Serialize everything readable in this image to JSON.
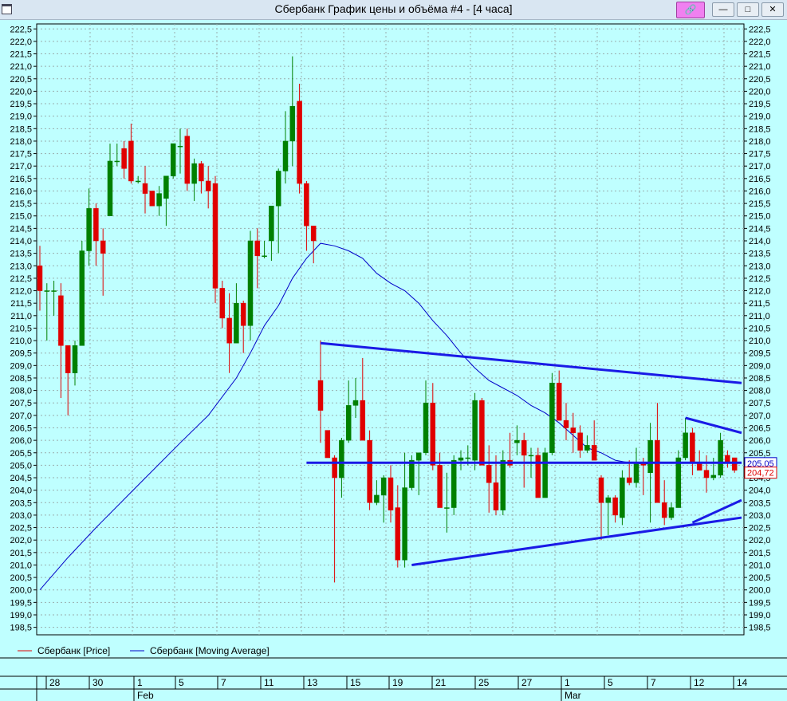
{
  "window": {
    "title": "Сбербанк График цены и объёма #4 - [4 часа]",
    "pin_icon": "pin-icon",
    "minimize_icon": "minimize-icon",
    "maximize_icon": "maximize-icon",
    "close_icon": "close-icon"
  },
  "colors": {
    "background": "#bfffff",
    "grid": "#9aaeae",
    "up": "#008000",
    "down": "#e00000",
    "ma": "#0000c8",
    "trendline": "#1a1ae6"
  },
  "legend": {
    "price": "Сбербанк [Price]",
    "ma": "Сбербанк [Moving Average]"
  },
  "price_labels": {
    "ma_last": "205,05",
    "price_last": "204,72"
  },
  "chart_data": {
    "type": "candlestick",
    "ylim": [
      198.2,
      222.7
    ],
    "y_ticks": [
      "222,5",
      "222,0",
      "221,5",
      "221,0",
      "220,5",
      "220,0",
      "219,5",
      "219,0",
      "218,5",
      "218,0",
      "217,5",
      "217,0",
      "216,5",
      "216,0",
      "215,5",
      "215,0",
      "214,5",
      "214,0",
      "213,5",
      "213,0",
      "212,5",
      "212,0",
      "211,5",
      "211,0",
      "210,5",
      "210,0",
      "209,5",
      "209,0",
      "208,5",
      "208,0",
      "207,5",
      "207,0",
      "206,5",
      "206,0",
      "205,5",
      "205,0",
      "204,5",
      "204,0",
      "203,5",
      "203,0",
      "202,5",
      "202,0",
      "201,5",
      "201,0",
      "200,5",
      "200,0",
      "199,5",
      "199,0",
      "198,5"
    ],
    "x_ticks": [
      "28",
      "30",
      "1",
      "5",
      "7",
      "11",
      "13",
      "15",
      "19",
      "21",
      "25",
      "27",
      "1",
      "5",
      "7",
      "12",
      "14"
    ],
    "month_labels": [
      "Feb",
      "Mar"
    ],
    "candles": [
      [
        213.0,
        213.8,
        211.2,
        212.0
      ],
      [
        212.0,
        212.3,
        210.0,
        212.0
      ],
      [
        212.0,
        212.4,
        211.0,
        212.0
      ],
      [
        211.8,
        212.3,
        207.7,
        209.8
      ],
      [
        209.8,
        209.8,
        207.0,
        208.7
      ],
      [
        208.7,
        210.0,
        208.2,
        209.8
      ],
      [
        209.8,
        214.0,
        209.8,
        213.6
      ],
      [
        213.6,
        216.1,
        213.0,
        215.3
      ],
      [
        215.3,
        215.5,
        213.0,
        214.0
      ],
      [
        214.0,
        214.5,
        211.8,
        213.5
      ],
      [
        215.0,
        217.9,
        215.0,
        217.2
      ],
      [
        217.2,
        217.9,
        217.0,
        217.2
      ],
      [
        217.7,
        218.0,
        216.5,
        216.9
      ],
      [
        218.0,
        218.7,
        216.3,
        216.4
      ],
      [
        216.4,
        216.6,
        216.3,
        216.4
      ],
      [
        216.3,
        217.0,
        215.1,
        215.9
      ],
      [
        216.0,
        216.0,
        215.4,
        215.4
      ],
      [
        215.4,
        216.2,
        215.0,
        215.9
      ],
      [
        215.7,
        216.5,
        214.6,
        216.6
      ],
      [
        216.6,
        217.8,
        216.5,
        217.9
      ],
      [
        217.8,
        218.5,
        216.7,
        217.8
      ],
      [
        218.2,
        218.5,
        216.0,
        216.3
      ],
      [
        216.3,
        217.3,
        215.6,
        217.1
      ],
      [
        217.1,
        217.2,
        215.9,
        216.4
      ],
      [
        216.4,
        217.0,
        215.3,
        216.0
      ],
      [
        216.3,
        216.6,
        211.5,
        212.1
      ],
      [
        212.1,
        212.4,
        210.5,
        210.9
      ],
      [
        210.9,
        211.9,
        208.7,
        209.9
      ],
      [
        209.9,
        212.3,
        209.9,
        211.5
      ],
      [
        211.5,
        211.6,
        209.5,
        210.6
      ],
      [
        210.6,
        214.4,
        210.0,
        214.0
      ],
      [
        214.0,
        214.5,
        212.1,
        213.4
      ],
      [
        213.4,
        214.0,
        213.3,
        213.4
      ],
      [
        214.0,
        215.0,
        213.2,
        215.4
      ],
      [
        215.4,
        216.9,
        213.5,
        216.8
      ],
      [
        216.8,
        219.2,
        216.3,
        218.0
      ],
      [
        218.0,
        221.4,
        217.0,
        219.4
      ],
      [
        219.6,
        220.3,
        215.9,
        216.3
      ],
      [
        216.3,
        216.4,
        213.6,
        214.6
      ],
      [
        214.6,
        214.6,
        213.1,
        214.0
      ],
      [
        208.4,
        210.0,
        205.9,
        207.2
      ],
      [
        206.4,
        206.3,
        205.4,
        205.3
      ],
      [
        205.3,
        205.4,
        200.3,
        204.5
      ],
      [
        204.5,
        206.1,
        203.7,
        206.0
      ],
      [
        206.0,
        208.4,
        205.9,
        207.4
      ],
      [
        207.4,
        208.5,
        206.9,
        207.6
      ],
      [
        207.6,
        209.3,
        206.9,
        206.0
      ],
      [
        206.0,
        206.4,
        203.2,
        203.5
      ],
      [
        203.5,
        204.4,
        203.4,
        203.8
      ],
      [
        203.8,
        204.6,
        202.7,
        204.5
      ],
      [
        204.5,
        205.0,
        202.7,
        203.2
      ],
      [
        203.3,
        204.2,
        200.9,
        201.2
      ],
      [
        201.2,
        205.5,
        200.9,
        204.1
      ],
      [
        204.1,
        205.4,
        204.0,
        205.2
      ],
      [
        205.2,
        205.5,
        203.8,
        205.5
      ],
      [
        205.5,
        208.4,
        205.4,
        207.5
      ],
      [
        207.5,
        208.3,
        204.8,
        205.0
      ],
      [
        205.0,
        205.5,
        203.6,
        203.3
      ],
      [
        203.3,
        204.7,
        202.3,
        203.3
      ],
      [
        203.3,
        205.4,
        203.0,
        205.2
      ],
      [
        205.2,
        205.6,
        204.8,
        205.3
      ],
      [
        205.3,
        205.8,
        205.0,
        205.3
      ],
      [
        205.2,
        207.9,
        204.8,
        207.6
      ],
      [
        207.6,
        207.7,
        205.9,
        205.0
      ],
      [
        205.0,
        205.8,
        203.1,
        204.3
      ],
      [
        204.3,
        205.4,
        203.0,
        203.2
      ],
      [
        203.2,
        205.6,
        203.0,
        205.2
      ],
      [
        205.2,
        206.3,
        204.9,
        205.0
      ],
      [
        205.9,
        206.6,
        205.4,
        206.0
      ],
      [
        206.0,
        206.3,
        204.1,
        205.4
      ],
      [
        205.4,
        205.7,
        204.5,
        205.4
      ],
      [
        205.4,
        205.7,
        203.9,
        203.7
      ],
      [
        203.7,
        205.7,
        204.2,
        205.5
      ],
      [
        205.5,
        208.7,
        205.4,
        208.3
      ],
      [
        208.3,
        208.8,
        206.9,
        206.8
      ],
      [
        206.8,
        207.5,
        206.0,
        206.5
      ],
      [
        206.5,
        207.1,
        205.5,
        206.3
      ],
      [
        206.3,
        206.6,
        205.3,
        205.6
      ],
      [
        205.6,
        206.2,
        205.5,
        205.8
      ],
      [
        205.8,
        206.8,
        205.3,
        205.2
      ],
      [
        204.5,
        204.6,
        202.0,
        203.5
      ],
      [
        203.5,
        203.8,
        202.2,
        203.7
      ],
      [
        203.7,
        203.8,
        202.7,
        203.0
      ],
      [
        202.9,
        204.8,
        202.6,
        204.5
      ],
      [
        204.5,
        205.2,
        204.2,
        204.3
      ],
      [
        204.3,
        205.7,
        204.1,
        205.1
      ],
      [
        205.1,
        205.3,
        203.8,
        205.0
      ],
      [
        204.7,
        206.7,
        202.7,
        206.0
      ],
      [
        206.0,
        207.5,
        204.4,
        203.5
      ],
      [
        203.5,
        204.4,
        202.6,
        202.9
      ],
      [
        202.9,
        203.5,
        202.8,
        203.3
      ],
      [
        203.3,
        205.6,
        203.4,
        205.3
      ],
      [
        205.3,
        206.9,
        205.2,
        206.3
      ],
      [
        206.3,
        206.5,
        204.6,
        205.1
      ],
      [
        205.1,
        205.6,
        204.8,
        204.8
      ],
      [
        204.8,
        205.4,
        203.9,
        204.5
      ],
      [
        204.5,
        205.3,
        204.4,
        204.6
      ],
      [
        204.6,
        206.3,
        204.5,
        206.0
      ],
      [
        205.4,
        205.6,
        204.9,
        205.1
      ],
      [
        205.3,
        205.3,
        204.7,
        204.8
      ]
    ],
    "moving_average": [
      [
        0,
        200.0
      ],
      [
        4,
        201.3
      ],
      [
        8,
        202.5
      ],
      [
        14,
        204.2
      ],
      [
        20,
        205.9
      ],
      [
        24,
        207.0
      ],
      [
        28,
        208.5
      ],
      [
        30,
        209.5
      ],
      [
        32,
        210.6
      ],
      [
        34,
        211.4
      ],
      [
        36,
        212.5
      ],
      [
        38,
        213.3
      ],
      [
        40,
        213.9
      ],
      [
        42,
        213.8
      ],
      [
        44,
        213.6
      ],
      [
        46,
        213.3
      ],
      [
        48,
        212.7
      ],
      [
        50,
        212.3
      ],
      [
        52,
        212.0
      ],
      [
        54,
        211.5
      ],
      [
        56,
        210.8
      ],
      [
        58,
        210.2
      ],
      [
        60,
        209.5
      ],
      [
        62,
        208.9
      ],
      [
        64,
        208.4
      ],
      [
        66,
        208.1
      ],
      [
        68,
        207.8
      ],
      [
        70,
        207.4
      ],
      [
        72,
        207.1
      ],
      [
        74,
        206.7
      ],
      [
        76,
        206.2
      ],
      [
        78,
        205.7
      ],
      [
        80,
        205.5
      ],
      [
        82,
        205.2
      ],
      [
        84,
        205.1
      ],
      [
        86,
        205.05
      ],
      [
        87,
        205.05
      ]
    ],
    "trendlines": [
      [
        [
          40,
          209.9
        ],
        [
          100,
          208.3
        ]
      ],
      [
        [
          38,
          205.1
        ],
        [
          100,
          205.1
        ]
      ],
      [
        [
          53,
          201.0
        ],
        [
          100,
          202.9
        ]
      ],
      [
        [
          92,
          206.9
        ],
        [
          100,
          206.3
        ]
      ],
      [
        [
          93,
          202.7
        ],
        [
          100,
          203.6
        ]
      ]
    ]
  }
}
